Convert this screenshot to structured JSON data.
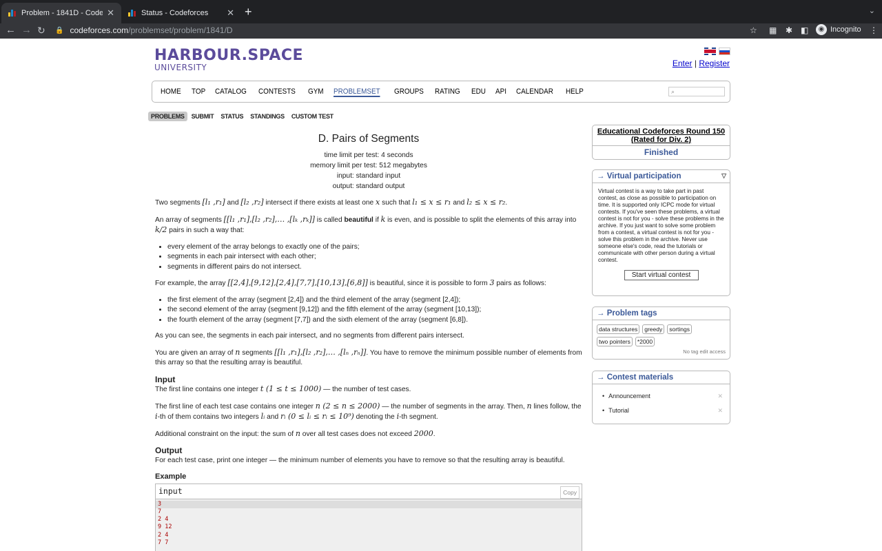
{
  "browser": {
    "tabs": [
      {
        "title": "Problem - 1841D - Codeforces",
        "active": true
      },
      {
        "title": "Status - Codeforces",
        "active": false
      }
    ],
    "new_tab": "+",
    "url_host": "codeforces.com",
    "url_path": "/problemset/problem/1841/D",
    "profile": "Incognito"
  },
  "header": {
    "logo_line1": "HARBOUR.SPACE",
    "logo_line2": "UNIVERSITY",
    "enter": "Enter",
    "separator": "|",
    "register": "Register"
  },
  "menu": {
    "items": [
      "HOME",
      "TOP",
      "CATALOG",
      "CONTESTS",
      "GYM",
      "PROBLEMSET",
      "GROUPS",
      "RATING",
      "EDU",
      "API",
      "CALENDAR",
      "HELP"
    ],
    "current": "PROBLEMSET"
  },
  "submenu": {
    "items": [
      "PROBLEMS",
      "SUBMIT",
      "STATUS",
      "STANDINGS",
      "CUSTOM TEST"
    ],
    "current": "PROBLEMS"
  },
  "problem": {
    "title": "D. Pairs of Segments",
    "time_limit": "time limit per test: 4 seconds",
    "memory_limit": "memory limit per test: 512 megabytes",
    "input": "input: standard input",
    "output": "output: standard output",
    "p1_a": "Two segments ",
    "p1_m1": "[l₁ ,r₁]",
    "p1_b": " and ",
    "p1_m2": "[l₂ ,r₂]",
    "p1_c": " intersect if there exists at least one ",
    "p1_m3": "x",
    "p1_d": " such that ",
    "p1_m4": "l₁ ≤ x ≤ r₁",
    "p1_e": " and ",
    "p1_m5": "l₂ ≤ x ≤ r₂",
    "p1_f": ".",
    "p2_a": "An array of segments ",
    "p2_m1": "[[l₁ ,r₁],[l₂ ,r₂],… ,[lₖ ,rₖ]]",
    "p2_b": " is called ",
    "p2_bold": "beautiful",
    "p2_c": " if ",
    "p2_m2": "k",
    "p2_d": " is even, and is possible to split the elements of this array into ",
    "p2_m3": "k/2",
    "p2_e": " pairs in such a way that:",
    "rules": [
      "every element of the array belongs to exactly one of the pairs;",
      "segments in each pair intersect with each other;",
      "segments in different pairs do not intersect."
    ],
    "ex_a": "For example, the array ",
    "ex_m1": "[[2,4],[9,12],[2,4],[7,7],[10,13],[6,8]]",
    "ex_b": " is beautiful, since it is possible to form ",
    "ex_m2": "3",
    "ex_c": " pairs as follows:",
    "pairs": [
      "the first element of the array (segment [2,4]) and the third element of the array (segment [2,4]);",
      "the second element of the array (segment [9,12]) and the fifth element of the array (segment [10,13]);",
      "the fourth element of the array (segment [7,7]) and the sixth element of the array (segment [6,8])."
    ],
    "note": "As you can see, the segments in each pair intersect, and no segments from different pairs intersect.",
    "task_a": "You are given an array of ",
    "task_m1": "n",
    "task_b": " segments ",
    "task_m2": "[[l₁ ,r₁],[l₂ ,r₂],… ,[lₙ ,rₙ]]",
    "task_c": ". You have to remove the minimum possible number of elements from this array so that the resulting array is beautiful.",
    "input_title": "Input",
    "in1_a": "The first line contains one integer ",
    "in1_m": "t (1 ≤ t ≤ 1000)",
    "in1_b": " — the number of test cases.",
    "in2_a": "The first line of each test case contains one integer ",
    "in2_m1": "n (2 ≤ n ≤ 2000)",
    "in2_b": " — the number of segments in the array. Then, ",
    "in2_m2": "n",
    "in2_c": " lines follow, the ",
    "in2_m3": "i",
    "in2_d": "-th of them contains two integers ",
    "in2_m4": "lᵢ",
    "in2_e": " and ",
    "in2_m5": "rᵢ",
    "in2_m6": " (0 ≤ lᵢ ≤ rᵢ ≤ 10⁹)",
    "in2_f": " denoting the ",
    "in2_m7": "i",
    "in2_g": "-th segment.",
    "in3_a": "Additional constraint on the input: the sum of ",
    "in3_m1": "n",
    "in3_b": " over all test cases does not exceed ",
    "in3_m2": "2000",
    "in3_c": ".",
    "output_title": "Output",
    "output_text": "For each test case, print one integer — the minimum number of elements you have to remove so that the resulting array is beautiful.",
    "example_title": "Example",
    "example_input_label": "input",
    "copy_label": "Copy",
    "example_lines": [
      "3",
      "7",
      "2 4",
      "9 12",
      "2 4",
      "7 7"
    ]
  },
  "sidebar": {
    "contest_name": "Educational Codeforces Round 150 (Rated for Div. 2)",
    "contest_status": "Finished",
    "virtual_title": "→ Virtual participation",
    "virtual_text": "Virtual contest is a way to take part in past contest, as close as possible to participation on time. It is supported only ICPC mode for virtual contests. If you've seen these problems, a virtual contest is not for you - solve these problems in the archive. If you just want to solve some problem from a contest, a virtual contest is not for you - solve this problem in the archive. Never use someone else's code, read the tutorials or communicate with other person during a virtual contest.",
    "virtual_button": "Start virtual contest",
    "tags_title": "→ Problem tags",
    "tags": [
      "data structures",
      "greedy",
      "sortings",
      "two pointers",
      "*2000"
    ],
    "no_tag_edit": "No tag edit access",
    "materials_title": "→ Contest materials",
    "materials": [
      "Announcement",
      "Tutorial"
    ]
  },
  "colors": {
    "accent": "#3b5998",
    "logo": "#5b4b9b",
    "link": "#0000cc"
  }
}
